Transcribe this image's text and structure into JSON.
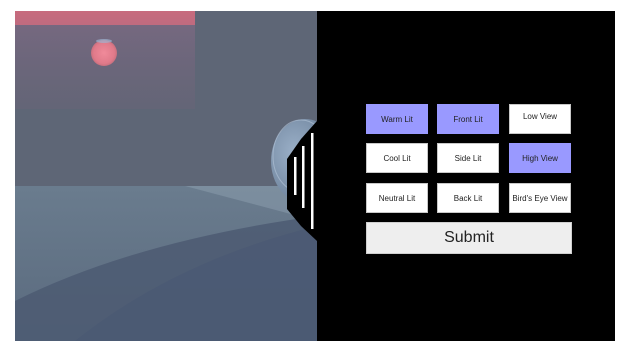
{
  "options": [
    {
      "label": "Warm Lit",
      "selected": true
    },
    {
      "label": "Front Lit",
      "selected": true
    },
    {
      "label": "Low View",
      "selected": false
    },
    {
      "label": "Cool Lit",
      "selected": false
    },
    {
      "label": "Side Lit",
      "selected": false
    },
    {
      "label": "High View",
      "selected": true
    },
    {
      "label": "Neutral Lit",
      "selected": false
    },
    {
      "label": "Back Lit",
      "selected": false
    },
    {
      "label": "Bird's Eye View",
      "selected": false
    }
  ],
  "submit_label": "Submit",
  "colors": {
    "selected": "#9999ff",
    "unselected": "#ffffff",
    "panel_background": "#000000",
    "scene_sky": "#5a6372",
    "sun": "#e07a8a"
  }
}
